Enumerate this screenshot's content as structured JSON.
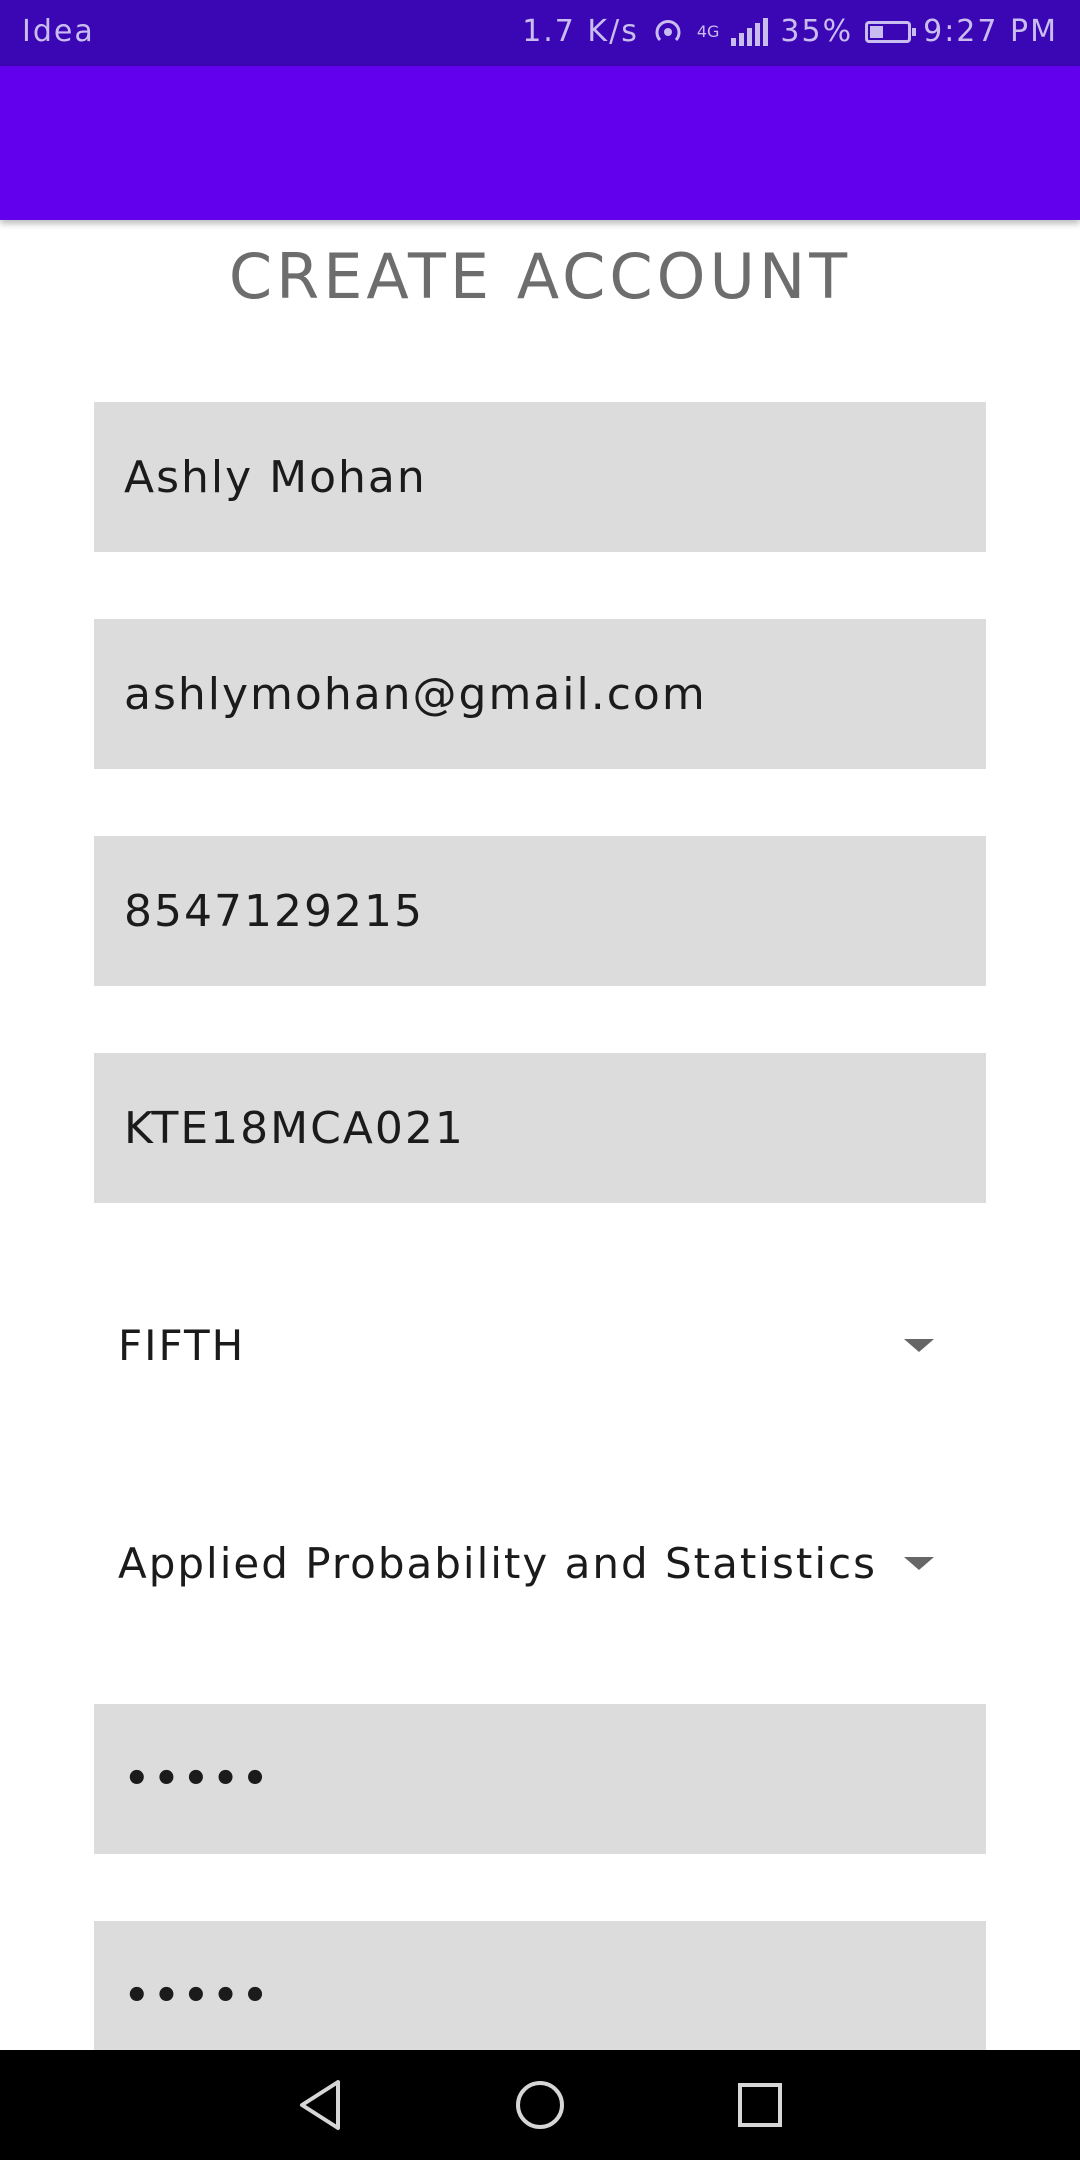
{
  "status_bar": {
    "carrier": "Idea",
    "net_speed": "1.7 K/s",
    "network_type": "4G",
    "battery_level": 0.35,
    "battery": "35%",
    "time": "9:27 PM"
  },
  "page": {
    "title": "CREATE ACCOUNT"
  },
  "form": {
    "name": "Ashly Mohan",
    "email": "ashlymohan@gmail.com",
    "phone": "8547129215",
    "register_no": "KTE18MCA021",
    "semester": "FIFTH",
    "subject": "Applied Probability and Statistics",
    "password": "•••••",
    "confirm_password": "•••••"
  },
  "colors": {
    "status_bar": "#3b06b3",
    "app_bar": "#6200ee",
    "field_bg": "#dcdcdc"
  },
  "icons": {
    "back": "back-icon",
    "home": "home-icon",
    "recents": "recents-icon"
  }
}
